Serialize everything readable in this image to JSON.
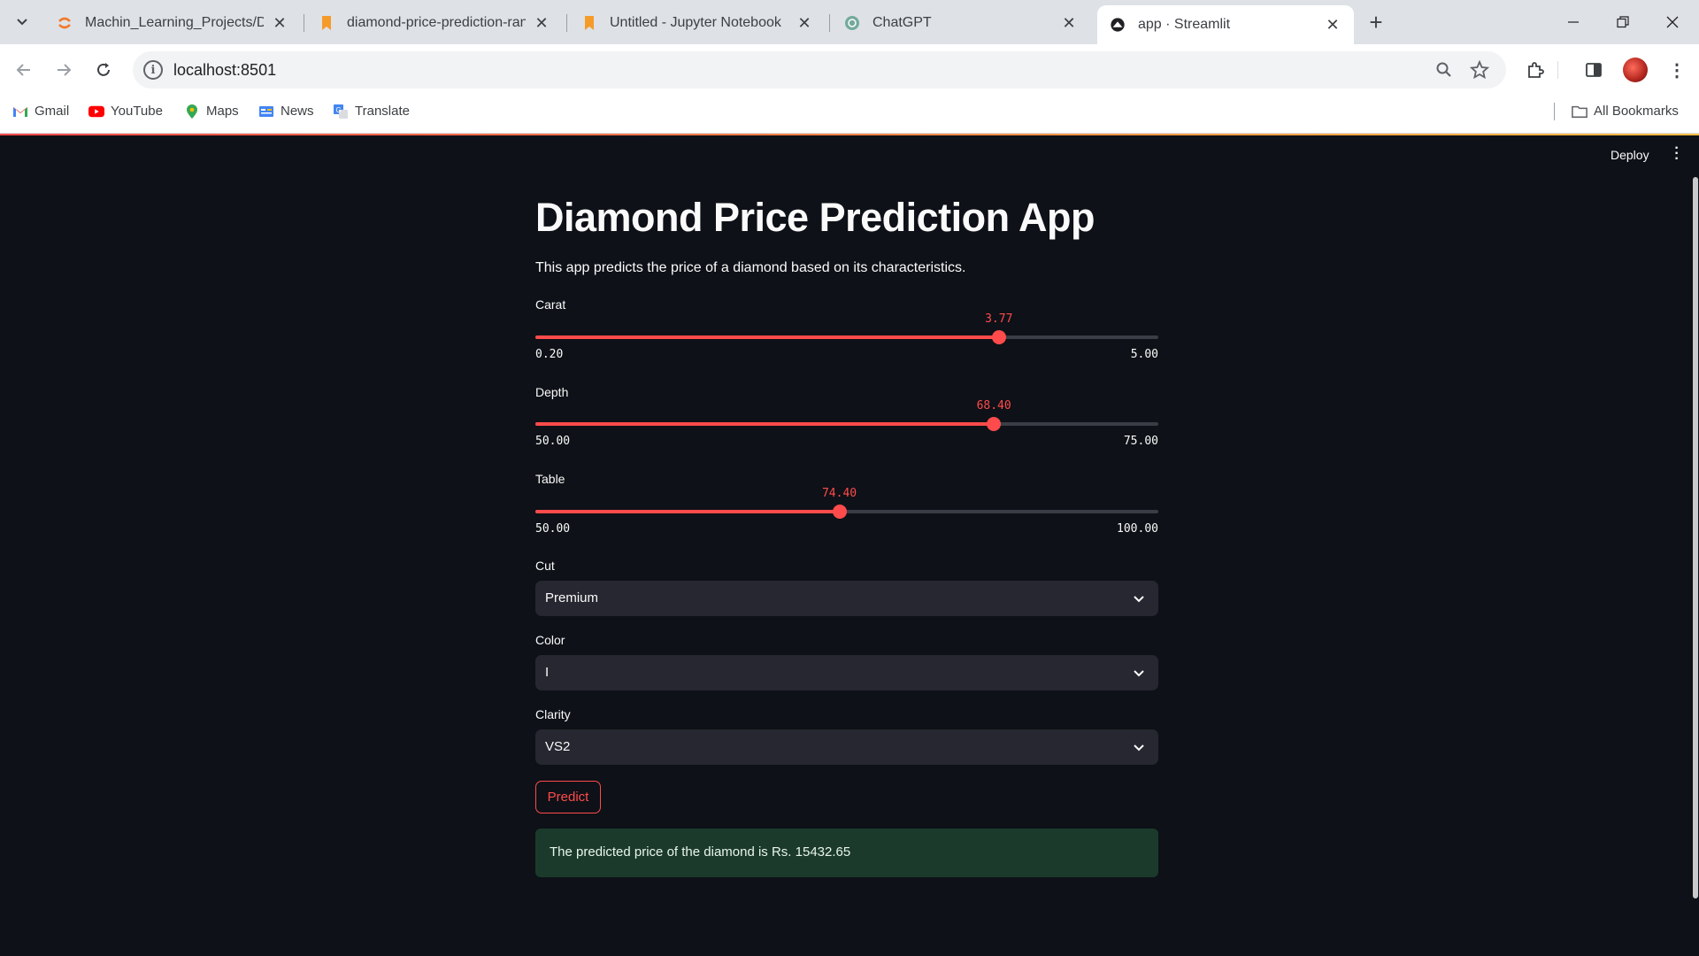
{
  "browser": {
    "tabs": [
      {
        "title": "Machin_Learning_Projects/Diam",
        "icon": "jupyter-icon"
      },
      {
        "title": "diamond-price-prediction-rand",
        "icon": "notebook-icon"
      },
      {
        "title": "Untitled - Jupyter Notebook",
        "icon": "notebook-icon"
      },
      {
        "title": "ChatGPT",
        "icon": "chatgpt-icon"
      },
      {
        "title": "app · Streamlit",
        "icon": "streamlit-icon",
        "active": true
      }
    ],
    "url": "localhost:8501",
    "bookmarks": [
      {
        "label": "Gmail",
        "icon": "gmail-icon"
      },
      {
        "label": "YouTube",
        "icon": "youtube-icon"
      },
      {
        "label": "Maps",
        "icon": "maps-icon"
      },
      {
        "label": "News",
        "icon": "news-icon"
      },
      {
        "label": "Translate",
        "icon": "translate-icon"
      }
    ],
    "all_bookmarks": "All Bookmarks"
  },
  "app": {
    "deploy_label": "Deploy",
    "title": "Diamond Price Prediction App",
    "subtitle": "This app predicts the price of a diamond based on its characteristics.",
    "sliders": [
      {
        "label": "Carat",
        "value": "3.77",
        "min": "0.20",
        "max": "5.00",
        "fraction": 0.744
      },
      {
        "label": "Depth",
        "value": "68.40",
        "min": "50.00",
        "max": "75.00",
        "fraction": 0.736
      },
      {
        "label": "Table",
        "value": "74.40",
        "min": "50.00",
        "max": "100.00",
        "fraction": 0.488
      }
    ],
    "selects": [
      {
        "label": "Cut",
        "value": "Premium"
      },
      {
        "label": "Color",
        "value": "I"
      },
      {
        "label": "Clarity",
        "value": "VS2"
      }
    ],
    "predict_label": "Predict",
    "result_text": "The predicted price of the diamond is Rs. 15432.65"
  },
  "colors": {
    "accent": "#ff4b4b",
    "background": "#0e1117",
    "widget_bg": "#262730",
    "success_bg": "#1b3a2b"
  }
}
